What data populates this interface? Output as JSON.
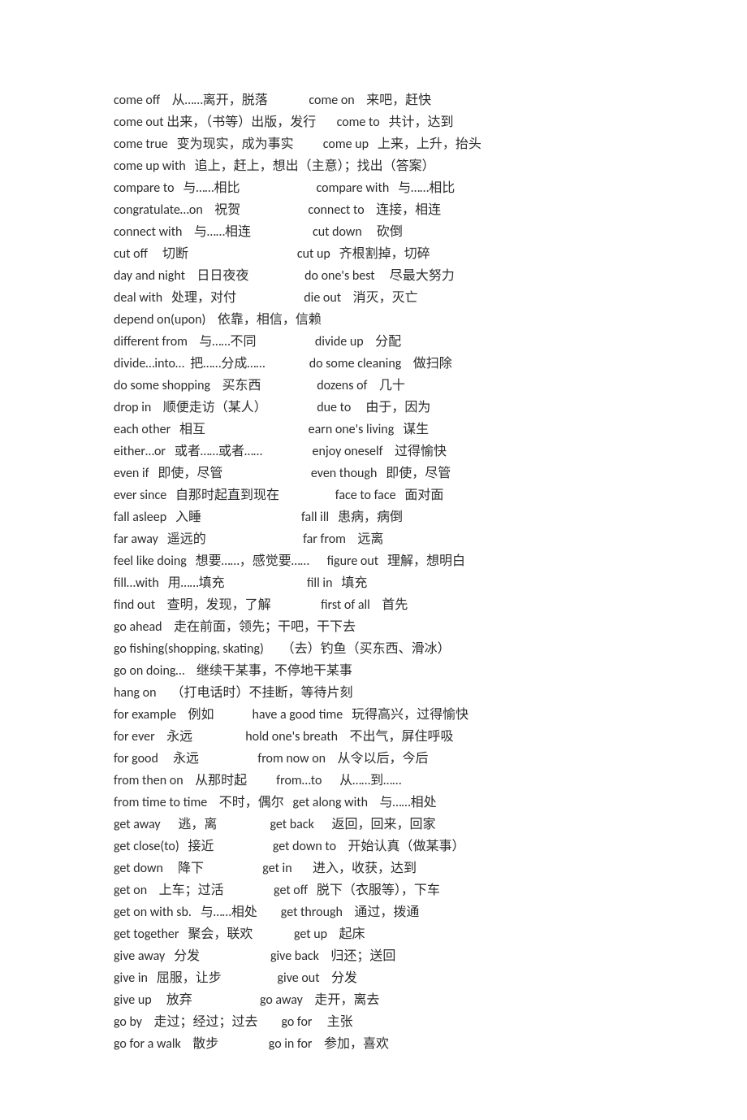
{
  "rows": [
    "come off    从……离开，脱落              come on    来吧，赶快",
    "come out 出来，（书等）出版，发行       come to   共计，达到",
    "come true   变为现实，成为事实          come up   上来，上升，抬头",
    "come up with   追上，赶上，想出（主意）；找出（答案）",
    "compare to   与……相比                          compare with   与……相比",
    "congratulate…on    祝贺                       connect to    连接，相连",
    "connect with    与……相连                     cut down     砍倒",
    "cut off     切断                                     cut up   齐根割掉，切碎",
    "day and night    日日夜夜                   do one's best     尽最大努力",
    "deal with   处理，对付                       die out    消灭，灭亡",
    "depend on(upon)    依靠，相信，信赖",
    "different from    与……不同                    divide up    分配",
    "divide…into…  把……分成……               do some cleaning    做扫除",
    "do some shopping    买东西                   dozens of    几十",
    "drop in    顺便走访（某人）                 due to     由于，因为",
    "each other   相互                                   earn one's living   谋生",
    "either…or   或者……或者……                 enjoy oneself    过得愉快",
    "even if   即使，尽管                              even though   即使，尽管",
    "ever since   自那时起直到现在                   face to face   面对面",
    "fall asleep   入睡                                  fall ill   患病，病倒",
    "far away   遥远的                                 far from    远离",
    "feel like doing   想要……，感觉要……      figure out   理解，想明白",
    "fill…with   用……填充                            fill in   填充",
    "find out    查明，发现，了解                 first of all    首先",
    "go ahead    走在前面，领先；干吧，干下去",
    "go fishing(shopping, skating)      （去）钓鱼（买东西、滑冰）",
    "go on doing…    继续干某事，不停地干某事",
    "hang on     （打电话时）不挂断，等待片刻",
    "for example    例如             have a good time   玩得高兴，过得愉快",
    "for ever    永远                  hold one's breath    不出气，屏住呼吸",
    "for good     永远                    from now on    从令以后，今后",
    "from then on    从那时起          from…to      从……到……",
    "from time to time    不时，偶尔   get along with    与……相处",
    "get away      逃，离                  get back      返回，回来，回家",
    "get close(to)   接近                    get down to    开始认真（做某事）",
    "get down     降下                    get in       进入，收获，达到",
    "get on    上车；过活                 get off   脱下（衣服等），下车",
    "get on with sb.   与……相处        get through    通过，拨通",
    "get together   聚会，联欢              get up    起床",
    "give away   分发                        give back    归还；送回",
    "give in   屈服，让步                   give out    分发",
    "give up     放弃                       go away    走开，离去",
    "go by    走过；经过；过去        go for     主张",
    "go for a walk    散步                 go in for    参加，喜欢"
  ]
}
